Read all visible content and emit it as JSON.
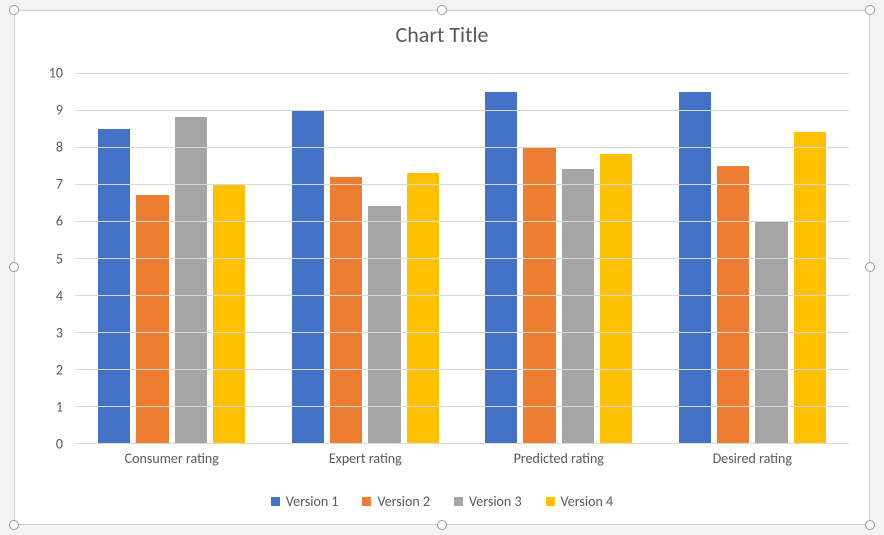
{
  "chart_data": {
    "type": "bar",
    "title": "Chart Title",
    "xlabel": "",
    "ylabel": "",
    "ylim": [
      0,
      10
    ],
    "y_ticks": [
      0,
      1,
      2,
      3,
      4,
      5,
      6,
      7,
      8,
      9,
      10
    ],
    "categories": [
      "Consumer rating",
      "Expert rating",
      "Predicted rating",
      "Desired rating"
    ],
    "series": [
      {
        "name": "Version 1",
        "color": "#4472c4",
        "values": [
          8.5,
          9.0,
          9.5,
          9.5
        ]
      },
      {
        "name": "Version 2",
        "color": "#ed7d31",
        "values": [
          6.7,
          7.2,
          8.0,
          7.5
        ]
      },
      {
        "name": "Version 3",
        "color": "#a5a5a5",
        "values": [
          8.8,
          6.4,
          7.4,
          6.0
        ]
      },
      {
        "name": "Version 4",
        "color": "#ffc000",
        "values": [
          7.0,
          7.3,
          7.8,
          8.4
        ]
      }
    ],
    "legend_position": "bottom",
    "grid": true
  }
}
